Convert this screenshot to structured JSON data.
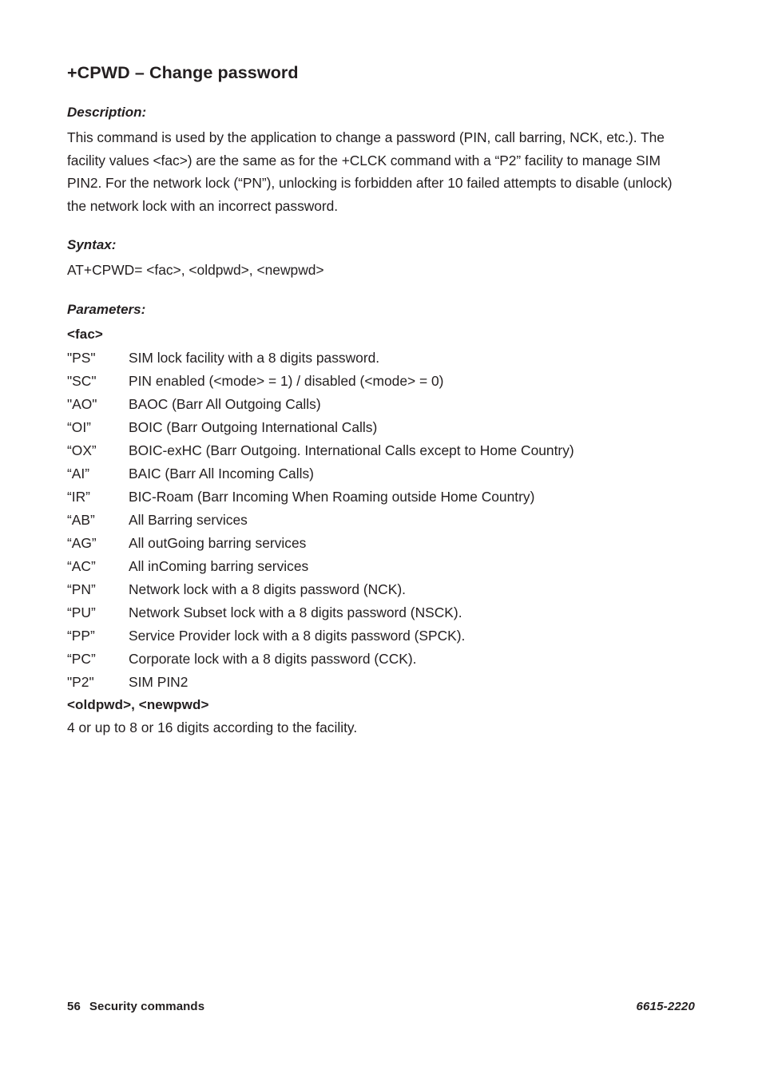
{
  "document": {
    "title": "+CPWD – Change password"
  },
  "sections": {
    "description": {
      "heading": "Description:",
      "text": "This command is used by the application to change a password (PIN, call barring, NCK, etc.). The facility values  <fac>) are the same as for the +CLCK command with a “P2” facility to manage SIM PIN2. For the network lock (“PN”), unlocking is forbidden after 10 failed attempts to disable (unlock) the network lock with an incorrect password."
    },
    "syntax": {
      "heading": "Syntax:",
      "text": "AT+CPWD= <fac>, <oldpwd>, <newpwd>"
    },
    "parameters": {
      "heading": "Parameters:",
      "fac_label": "<fac>",
      "rows": [
        {
          "code": "\"PS\"",
          "desc": "SIM lock facility with a 8 digits password."
        },
        {
          "code": "\"SC\"",
          "desc": "PIN enabled (<mode> = 1) / disabled (<mode> = 0)"
        },
        {
          "code": "\"AO\"",
          "desc": "BAOC (Barr All Outgoing Calls)"
        },
        {
          "code": "“OI”",
          "desc": "BOIC (Barr Outgoing International Calls)"
        },
        {
          "code": "“OX”",
          "desc": "BOIC-exHC (Barr Outgoing. International Calls except to Home Country)"
        },
        {
          "code": "“AI”",
          "desc": "BAIC (Barr All Incoming Calls)"
        },
        {
          "code": "“IR”",
          "desc": "BIC-Roam (Barr Incoming When Roaming outside Home Country)"
        },
        {
          "code": "“AB”",
          "desc": "All Barring services"
        },
        {
          "code": "“AG”",
          "desc": "All outGoing barring services"
        },
        {
          "code": "“AC”",
          "desc": "All inComing barring services"
        },
        {
          "code": "“PN”",
          "desc": "Network lock with a 8 digits password (NCK)."
        },
        {
          "code": "“PU”",
          "desc": "Network Subset lock with a 8 digits password (NSCK)."
        },
        {
          "code": "“PP”",
          "desc": "Service Provider lock with a 8 digits password (SPCK)."
        },
        {
          "code": "“PC”",
          "desc": "Corporate lock with a 8 digits password (CCK)."
        },
        {
          "code": "\"P2\"",
          "desc": "SIM PIN2"
        }
      ],
      "pwd_label": "<oldpwd>, <newpwd>",
      "pwd_text": "4 or up to 8 or 16 digits according to the facility."
    }
  },
  "footer": {
    "page_number": "56",
    "section_name": "Security commands",
    "document_code": "6615-2220"
  },
  "colors": {
    "text": "#231f20",
    "background": "#ffffff"
  }
}
